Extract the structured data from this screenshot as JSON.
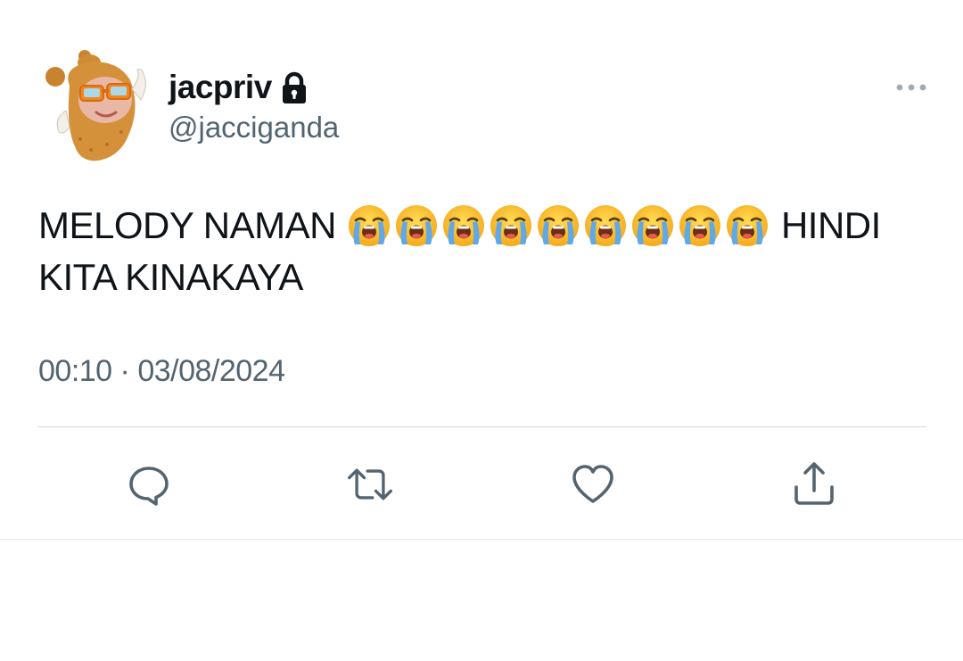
{
  "tweet": {
    "display_name": "jacpriv",
    "handle": "@jacciganda",
    "locked": true,
    "text_line1_before": "MELODY NAMAN",
    "text_line1_after": "HINDI",
    "text_line2": "KITA KINAKAYA",
    "emoji": "loudly-crying-face",
    "emoji_count": 9,
    "time": "00:10",
    "separator": "·",
    "date": "03/08/2024"
  },
  "actions": [
    {
      "name": "reply",
      "icon": "speech-bubble-icon"
    },
    {
      "name": "retweet",
      "icon": "retweet-arrows-icon"
    },
    {
      "name": "like",
      "icon": "heart-icon"
    },
    {
      "name": "share",
      "icon": "share-upload-icon"
    }
  ],
  "colors": {
    "primary_text": "#0f1419",
    "secondary_text": "#536471",
    "divider": "#cfd9de",
    "background": "#ffffff"
  }
}
